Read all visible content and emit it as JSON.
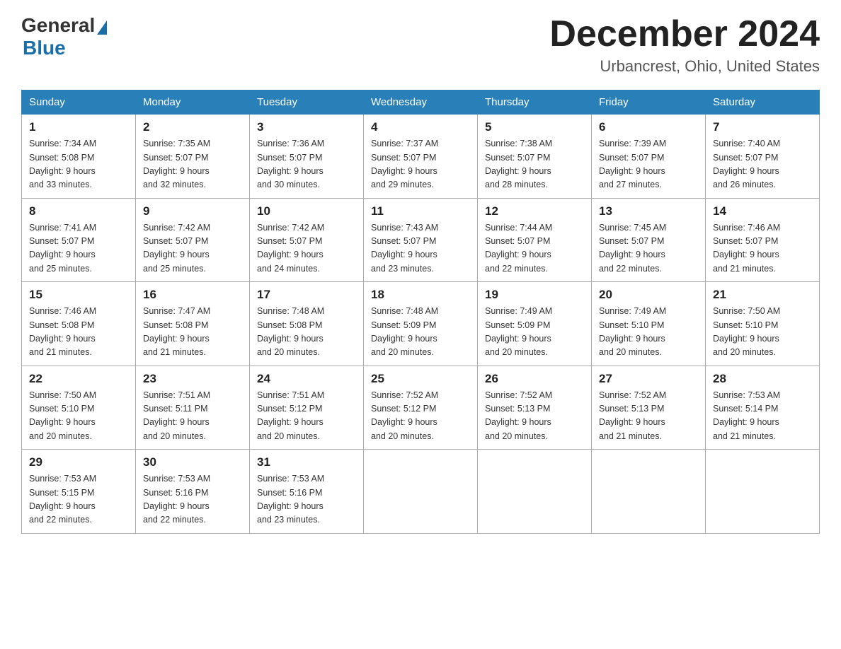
{
  "header": {
    "logo_general": "General",
    "logo_blue": "Blue",
    "month_title": "December 2024",
    "location": "Urbancrest, Ohio, United States"
  },
  "days_of_week": [
    "Sunday",
    "Monday",
    "Tuesday",
    "Wednesday",
    "Thursday",
    "Friday",
    "Saturday"
  ],
  "weeks": [
    [
      {
        "day": "1",
        "sunrise": "7:34 AM",
        "sunset": "5:08 PM",
        "daylight": "9 hours and 33 minutes."
      },
      {
        "day": "2",
        "sunrise": "7:35 AM",
        "sunset": "5:07 PM",
        "daylight": "9 hours and 32 minutes."
      },
      {
        "day": "3",
        "sunrise": "7:36 AM",
        "sunset": "5:07 PM",
        "daylight": "9 hours and 30 minutes."
      },
      {
        "day": "4",
        "sunrise": "7:37 AM",
        "sunset": "5:07 PM",
        "daylight": "9 hours and 29 minutes."
      },
      {
        "day": "5",
        "sunrise": "7:38 AM",
        "sunset": "5:07 PM",
        "daylight": "9 hours and 28 minutes."
      },
      {
        "day": "6",
        "sunrise": "7:39 AM",
        "sunset": "5:07 PM",
        "daylight": "9 hours and 27 minutes."
      },
      {
        "day": "7",
        "sunrise": "7:40 AM",
        "sunset": "5:07 PM",
        "daylight": "9 hours and 26 minutes."
      }
    ],
    [
      {
        "day": "8",
        "sunrise": "7:41 AM",
        "sunset": "5:07 PM",
        "daylight": "9 hours and 25 minutes."
      },
      {
        "day": "9",
        "sunrise": "7:42 AM",
        "sunset": "5:07 PM",
        "daylight": "9 hours and 25 minutes."
      },
      {
        "day": "10",
        "sunrise": "7:42 AM",
        "sunset": "5:07 PM",
        "daylight": "9 hours and 24 minutes."
      },
      {
        "day": "11",
        "sunrise": "7:43 AM",
        "sunset": "5:07 PM",
        "daylight": "9 hours and 23 minutes."
      },
      {
        "day": "12",
        "sunrise": "7:44 AM",
        "sunset": "5:07 PM",
        "daylight": "9 hours and 22 minutes."
      },
      {
        "day": "13",
        "sunrise": "7:45 AM",
        "sunset": "5:07 PM",
        "daylight": "9 hours and 22 minutes."
      },
      {
        "day": "14",
        "sunrise": "7:46 AM",
        "sunset": "5:07 PM",
        "daylight": "9 hours and 21 minutes."
      }
    ],
    [
      {
        "day": "15",
        "sunrise": "7:46 AM",
        "sunset": "5:08 PM",
        "daylight": "9 hours and 21 minutes."
      },
      {
        "day": "16",
        "sunrise": "7:47 AM",
        "sunset": "5:08 PM",
        "daylight": "9 hours and 21 minutes."
      },
      {
        "day": "17",
        "sunrise": "7:48 AM",
        "sunset": "5:08 PM",
        "daylight": "9 hours and 20 minutes."
      },
      {
        "day": "18",
        "sunrise": "7:48 AM",
        "sunset": "5:09 PM",
        "daylight": "9 hours and 20 minutes."
      },
      {
        "day": "19",
        "sunrise": "7:49 AM",
        "sunset": "5:09 PM",
        "daylight": "9 hours and 20 minutes."
      },
      {
        "day": "20",
        "sunrise": "7:49 AM",
        "sunset": "5:10 PM",
        "daylight": "9 hours and 20 minutes."
      },
      {
        "day": "21",
        "sunrise": "7:50 AM",
        "sunset": "5:10 PM",
        "daylight": "9 hours and 20 minutes."
      }
    ],
    [
      {
        "day": "22",
        "sunrise": "7:50 AM",
        "sunset": "5:10 PM",
        "daylight": "9 hours and 20 minutes."
      },
      {
        "day": "23",
        "sunrise": "7:51 AM",
        "sunset": "5:11 PM",
        "daylight": "9 hours and 20 minutes."
      },
      {
        "day": "24",
        "sunrise": "7:51 AM",
        "sunset": "5:12 PM",
        "daylight": "9 hours and 20 minutes."
      },
      {
        "day": "25",
        "sunrise": "7:52 AM",
        "sunset": "5:12 PM",
        "daylight": "9 hours and 20 minutes."
      },
      {
        "day": "26",
        "sunrise": "7:52 AM",
        "sunset": "5:13 PM",
        "daylight": "9 hours and 20 minutes."
      },
      {
        "day": "27",
        "sunrise": "7:52 AM",
        "sunset": "5:13 PM",
        "daylight": "9 hours and 21 minutes."
      },
      {
        "day": "28",
        "sunrise": "7:53 AM",
        "sunset": "5:14 PM",
        "daylight": "9 hours and 21 minutes."
      }
    ],
    [
      {
        "day": "29",
        "sunrise": "7:53 AM",
        "sunset": "5:15 PM",
        "daylight": "9 hours and 22 minutes."
      },
      {
        "day": "30",
        "sunrise": "7:53 AM",
        "sunset": "5:16 PM",
        "daylight": "9 hours and 22 minutes."
      },
      {
        "day": "31",
        "sunrise": "7:53 AM",
        "sunset": "5:16 PM",
        "daylight": "9 hours and 23 minutes."
      },
      null,
      null,
      null,
      null
    ]
  ]
}
